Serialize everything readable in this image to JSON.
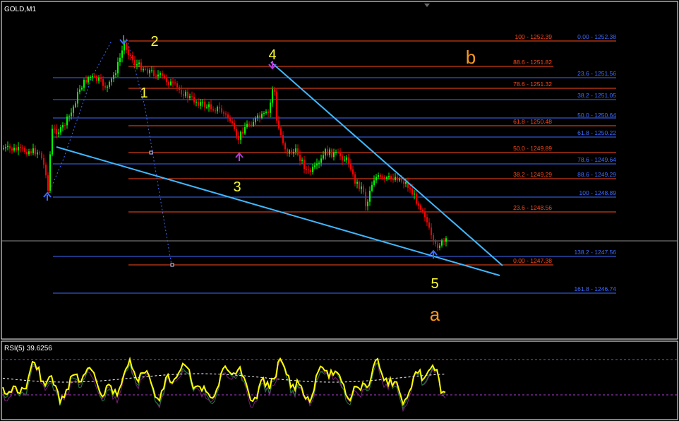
{
  "window": {
    "symbol_title": "GOLD,M1"
  },
  "colors": {
    "background": "#000000",
    "bull_candle": "#00ff00",
    "bear_candle": "#ff0000",
    "fib_red": "#ff4a1a",
    "fib_blue": "#3d6bff",
    "channel_line": "#3fb8ff",
    "wave_number": "#ffff33",
    "wave_letter": "#ff9a1a",
    "rsi_line": "#ffff00"
  },
  "fib_retracement": [
    {
      "text": "100 - 1252.39"
    },
    {
      "text": "88.6 - 1251.82"
    },
    {
      "text": "78.6 - 1251.32"
    },
    {
      "text": "61.8 - 1250.48"
    },
    {
      "text": "50.0 - 1249.89"
    },
    {
      "text": "38.2 - 1249.29"
    },
    {
      "text": "23.6 - 1248.56"
    },
    {
      "text": "0.00 - 1247.38"
    }
  ],
  "fib_extension": [
    {
      "text": "0.00 - 1252.38"
    },
    {
      "text": "23.6 - 1251.56"
    },
    {
      "text": "38.2 - 1251.05"
    },
    {
      "text": "50.0 - 1250.64"
    },
    {
      "text": "61.8 - 1250.22"
    },
    {
      "text": "78.6 - 1249.64"
    },
    {
      "text": "88.6 - 1249.29"
    },
    {
      "text": "100 - 1248.89"
    },
    {
      "text": "138.2 - 1247.56"
    },
    {
      "text": "161.8 - 1246.74"
    }
  ],
  "wave_labels": {
    "w1": "1",
    "w2": "2",
    "w3": "3",
    "w4": "4",
    "w5": "5",
    "wa": "a",
    "wb": "b"
  },
  "rsi": {
    "label": "RSI(5) 39.6256",
    "value": 39.6256
  }
}
